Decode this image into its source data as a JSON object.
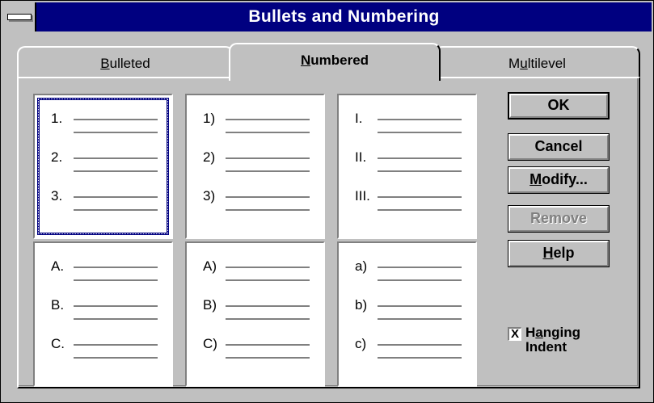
{
  "window": {
    "title": "Bullets and Numbering"
  },
  "tabs": [
    {
      "pre": "",
      "key": "B",
      "post": "ulleted",
      "active": false
    },
    {
      "pre": "",
      "key": "N",
      "post": "umbered",
      "active": true
    },
    {
      "pre": "M",
      "key": "u",
      "post": "ltilevel",
      "active": false
    }
  ],
  "styles": [
    {
      "labels": [
        "1.",
        "2.",
        "3."
      ],
      "selected": true
    },
    {
      "labels": [
        "1)",
        "2)",
        "3)"
      ],
      "selected": false
    },
    {
      "labels": [
        "I.",
        "II.",
        "III."
      ],
      "selected": false
    },
    {
      "labels": [
        "A.",
        "B.",
        "C."
      ],
      "selected": false
    },
    {
      "labels": [
        "A)",
        "B)",
        "C)"
      ],
      "selected": false
    },
    {
      "labels": [
        "a)",
        "b)",
        "c)"
      ],
      "selected": false
    }
  ],
  "buttons": {
    "ok": {
      "label": "OK"
    },
    "cancel": {
      "label": "Cancel"
    },
    "modify": {
      "key": "M",
      "rest": "odify..."
    },
    "remove": {
      "label": "Remove"
    },
    "help": {
      "key": "H",
      "rest": "elp"
    }
  },
  "hanging_indent": {
    "checked": true,
    "mark": "X",
    "pre": "H",
    "key": "a",
    "post": "nging",
    "line2": "Indent"
  }
}
